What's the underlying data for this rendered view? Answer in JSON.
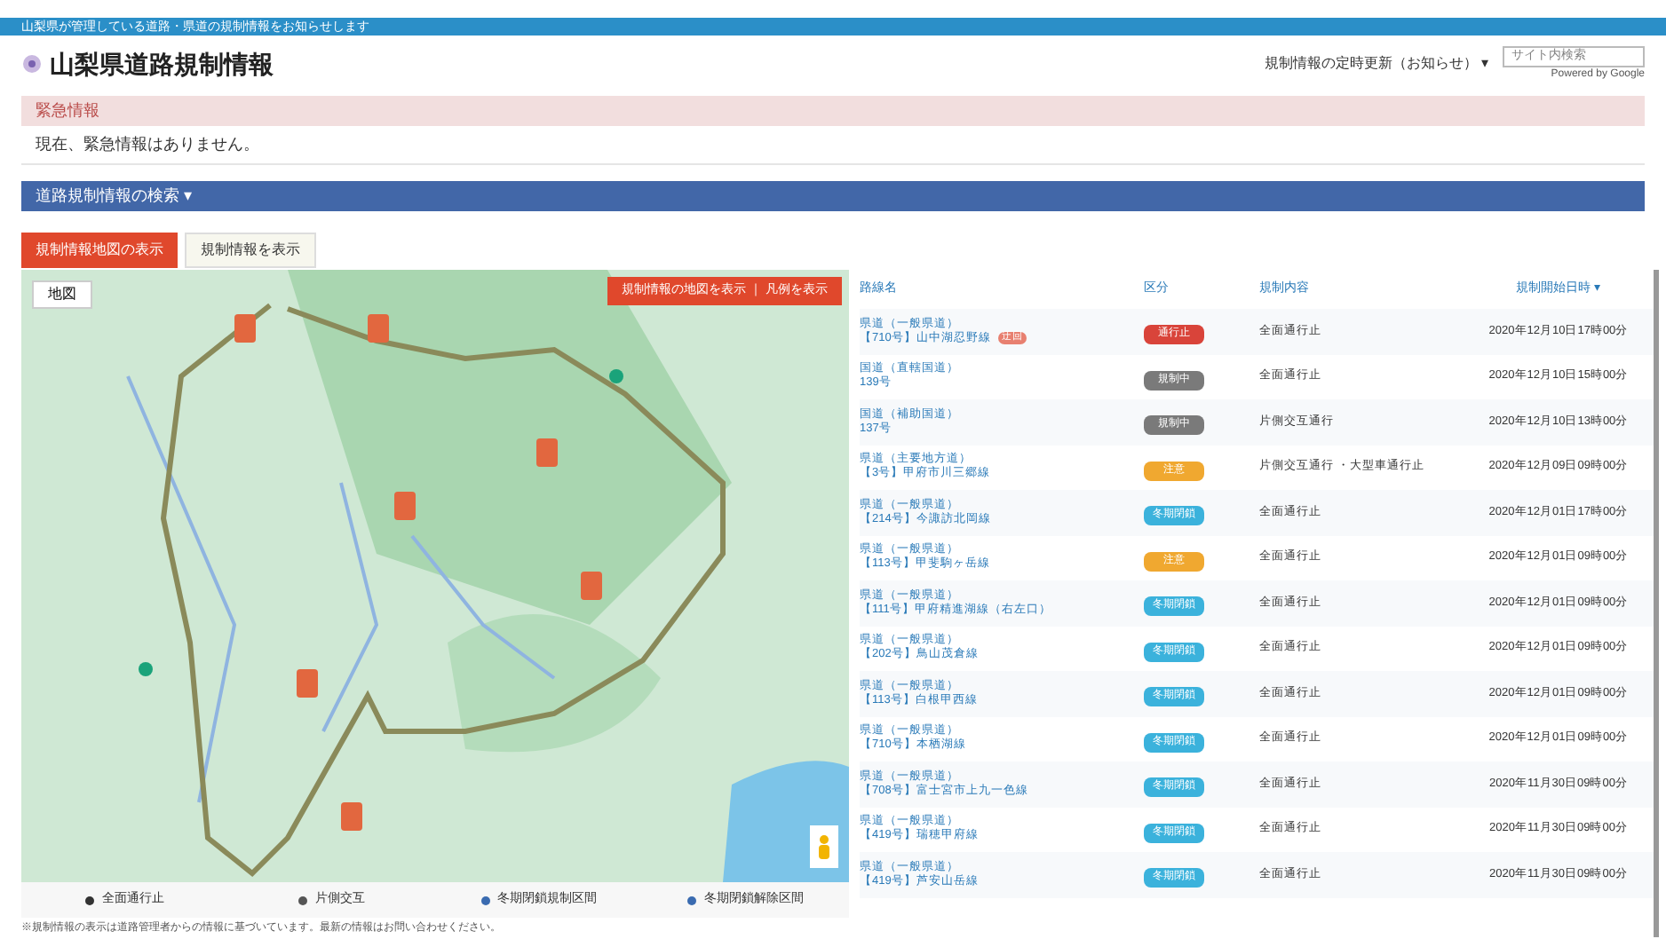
{
  "top_bar": {
    "text": "山梨県が管理している道路・県道の規制情報をお知らせします"
  },
  "header": {
    "title": "山梨県道路規制情報",
    "menu": "規制情報の定時更新（お知らせ） ▾",
    "search": {
      "placeholder": "サイト内検索"
    },
    "powered": "Powered by Google"
  },
  "alert": {
    "title": "緊急情報",
    "body": "現在、緊急情報はありません。"
  },
  "search_bar": {
    "label": "道路規制情報の検索 ▾"
  },
  "tabs": [
    {
      "label": "規制情報地図の表示",
      "selected": true
    },
    {
      "label": "規制情報を表示",
      "selected": false
    }
  ],
  "map": {
    "type_button": "地図",
    "banner": "規制情報の地図を表示 ｜ 凡例を表示"
  },
  "legend": [
    {
      "label": "全面通行止",
      "color": "#333333"
    },
    {
      "label": "片側交互",
      "color": "#555555"
    },
    {
      "label": "冬期閉鎖規制区間",
      "color": "#3a6bb0"
    },
    {
      "label": "冬期閉鎖解除区間",
      "color": "#3a6bb0"
    }
  ],
  "note": "※規制情報の表示は道路管理者からの情報に基づいています。最新の情報はお問い合わせください。",
  "table": {
    "columns": [
      "路線名",
      "区分",
      "規制内容",
      "規制開始日時 ▾"
    ],
    "rows": [
      {
        "route": "県道（一般県道）",
        "section": "【710号】山中湖忍野線",
        "flag": "迂回",
        "status": "通行止",
        "kind": "closed",
        "content": "全面通行止",
        "start": "2020年12月10日17時00分"
      },
      {
        "route": "国道（直轄国道）",
        "section": "139号",
        "status": "規制中",
        "kind": "restricted",
        "content": "全面通行止",
        "start": "2020年12月10日15時00分"
      },
      {
        "route": "国道（補助国道）",
        "section": "137号",
        "status": "規制中",
        "kind": "restricted",
        "content": "片側交互通行",
        "start": "2020年12月10日13時00分"
      },
      {
        "route": "県道（主要地方道）",
        "section": "【3号】甲府市川三郷線",
        "status": "注意",
        "kind": "caution",
        "content": "片側交互通行 ・大型車通行止",
        "start": "2020年12月09日09時00分"
      },
      {
        "route": "県道（一般県道）",
        "section": "【214号】今諏訪北岡線",
        "status": "冬期閉鎖",
        "kind": "winter",
        "content": "全面通行止",
        "start": "2020年12月01日17時00分"
      },
      {
        "route": "県道（一般県道）",
        "section": "【113号】甲斐駒ヶ岳線",
        "status": "注意",
        "kind": "caution",
        "content": "全面通行止",
        "start": "2020年12月01日09時00分"
      },
      {
        "route": "県道（一般県道）",
        "section": "【111号】甲府精進湖線（右左口）",
        "status": "冬期閉鎖",
        "kind": "winter",
        "content": "全面通行止",
        "start": "2020年12月01日09時00分"
      },
      {
        "route": "県道（一般県道）",
        "section": "【202号】鳥山茂倉線",
        "status": "冬期閉鎖",
        "kind": "winter",
        "content": "全面通行止",
        "start": "2020年12月01日09時00分"
      },
      {
        "route": "県道（一般県道）",
        "section": "【113号】白根甲西線",
        "status": "冬期閉鎖",
        "kind": "winter",
        "content": "全面通行止",
        "start": "2020年12月01日09時00分"
      },
      {
        "route": "県道（一般県道）",
        "section": "【710号】本栖湖線",
        "status": "冬期閉鎖",
        "kind": "winter",
        "content": "全面通行止",
        "start": "2020年12月01日09時00分"
      },
      {
        "route": "県道（一般県道）",
        "section": "【708号】富士宮市上九一色線",
        "status": "冬期閉鎖",
        "kind": "winter",
        "content": "全面通行止",
        "start": "2020年11月30日09時00分"
      },
      {
        "route": "県道（一般県道）",
        "section": "【419号】瑞穂甲府線",
        "status": "冬期閉鎖",
        "kind": "winter",
        "content": "全面通行止",
        "start": "2020年11月30日09時00分"
      },
      {
        "route": "県道（一般県道）",
        "section": "【419号】芦安山岳線",
        "status": "冬期閉鎖",
        "kind": "winter",
        "content": "全面通行止",
        "start": "2020年11月30日09時00分"
      }
    ]
  }
}
